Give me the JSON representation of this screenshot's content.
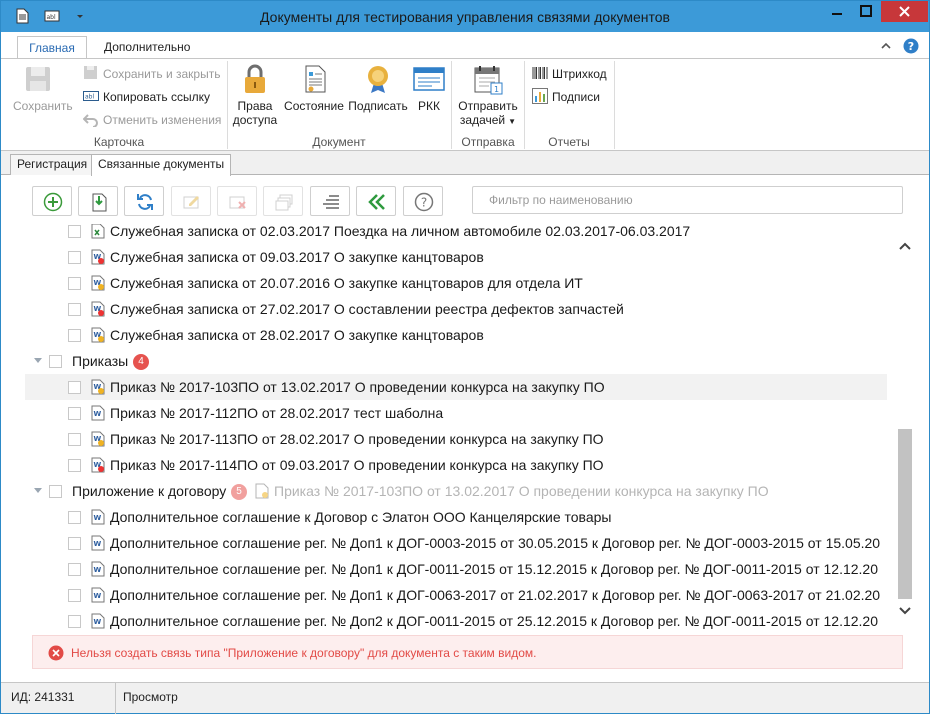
{
  "window": {
    "title": "Документы для тестирования управления связями документов"
  },
  "ribbon_tabs": {
    "main": "Главная",
    "extra": "Дополнительно"
  },
  "ribbon": {
    "card": {
      "save": "Сохранить",
      "save_close": "Сохранить и закрыть",
      "copy_link": "Копировать ссылку",
      "undo": "Отменить изменения",
      "label": "Карточка"
    },
    "document": {
      "access_line1": "Права",
      "access_line2": "доступа",
      "state": "Состояние",
      "sign": "Подписать",
      "rkk": "РКК",
      "label": "Документ"
    },
    "send": {
      "line1": "Отправить",
      "line2": "задачей",
      "label": "Отправка"
    },
    "reports": {
      "barcode": "Штрихкод",
      "signatures": "Подписи",
      "label": "Отчеты"
    }
  },
  "doc_tabs": {
    "registration": "Регистрация",
    "related": "Связанные документы"
  },
  "toolbar": {
    "filter_placeholder": "Фильтр по наименованию"
  },
  "list": {
    "memos": [
      "Служебная записка от 02.03.2017 Поездка на личном автомобиле 02.03.2017-06.03.2017",
      "Служебная записка от 09.03.2017 О закупке канцтоваров",
      "Служебная записка от 20.07.2016 О закупке канцтоваров для отдела ИТ",
      "Служебная записка от 27.02.2017 О составлении реестра дефектов запчастей",
      "Служебная записка от 28.02.2017 О закупке канцтоваров"
    ],
    "orders_group": {
      "label": "Приказы",
      "count": "4"
    },
    "orders": [
      "Приказ № 2017-103ПО от 13.02.2017 О проведении конкурса на закупку ПО",
      "Приказ № 2017-112ПО от 28.02.2017 тест шаболна",
      "Приказ № 2017-113ПО от 28.02.2017 О проведении конкурса на закупку ПО",
      "Приказ № 2017-114ПО от 09.03.2017 О проведении конкурса на закупку ПО"
    ],
    "appendix_group": {
      "label": "Приложение к договору",
      "count": "5",
      "drag_text": "Приказ № 2017-103ПО от 13.02.2017 О проведении конкурса на закупку ПО"
    },
    "appendices": [
      "Дополнительное соглашение к Договор с Элатон ООО Канцелярские товары",
      "Дополнительное соглашение рег. № Доп1 к ДОГ-0003-2015 от 30.05.2015 к Договор рег. № ДОГ-0003-2015 от 15.05.20",
      "Дополнительное соглашение рег. № Доп1 к ДОГ-0011-2015 от 15.12.2015 к Договор рег. № ДОГ-0011-2015 от 12.12.20",
      "Дополнительное соглашение рег. № Доп1 к ДОГ-0063-2017 от 21.02.2017 к Договор рег. № ДОГ-0063-2017 от 21.02.20",
      "Дополнительное соглашение рег. № Доп2 к ДОГ-0011-2015 от 25.12.2015 к Договор рег. № ДОГ-0011-2015 от 12.12.20"
    ]
  },
  "error": {
    "message": "Нельзя создать связь типа \"Приложение к договору\" для документа с таким видом."
  },
  "status": {
    "id": "ИД: 241331",
    "mode": "Просмотр"
  },
  "colors": {
    "accent": "#3c9ad8",
    "error": "#e24a46",
    "badge": "#e6534f"
  }
}
